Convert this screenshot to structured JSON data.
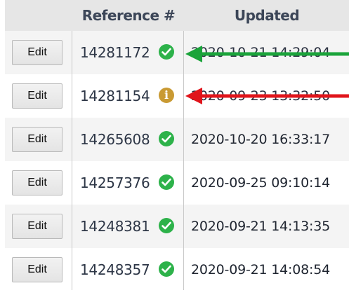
{
  "header": {
    "reference_label": "Reference #",
    "updated_label": "Updated"
  },
  "rows": [
    {
      "edit_label": "Edit",
      "reference": "14281172",
      "status": "ok",
      "updated": "2020-10-21 14:29:04"
    },
    {
      "edit_label": "Edit",
      "reference": "14281154",
      "status": "info",
      "updated": "2020-09-23 13:32:50"
    },
    {
      "edit_label": "Edit",
      "reference": "14265608",
      "status": "ok",
      "updated": "2020-10-20 16:33:17"
    },
    {
      "edit_label": "Edit",
      "reference": "14257376",
      "status": "ok",
      "updated": "2020-09-25 09:10:14"
    },
    {
      "edit_label": "Edit",
      "reference": "14248381",
      "status": "ok",
      "updated": "2020-09-21 14:13:35"
    },
    {
      "edit_label": "Edit",
      "reference": "14248357",
      "status": "ok",
      "updated": "2020-09-21 14:08:54"
    }
  ],
  "annotations": {
    "green_arrow_color": "#1aa33a",
    "red_arrow_color": "#e0141b",
    "ok_icon": "check-circle-icon",
    "info_icon": "info-circle-icon"
  }
}
